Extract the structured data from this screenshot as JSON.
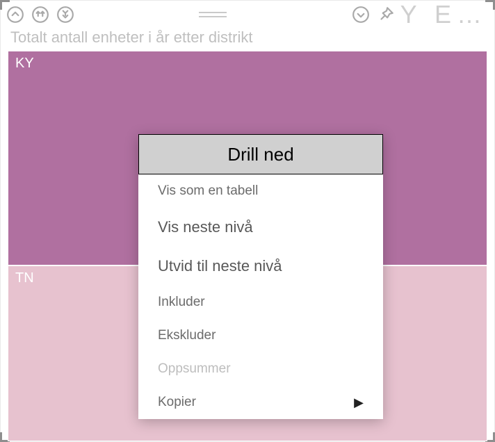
{
  "toolbar": {
    "collapsed_title": "Y E…"
  },
  "chart": {
    "title": "Totalt antall enheter i år etter distrikt"
  },
  "bars": {
    "ky": {
      "label": "KY"
    },
    "tn": {
      "label": "TN"
    }
  },
  "menu": {
    "drill_down": "Drill ned",
    "show_as_table": "Vis som en tabell",
    "show_next_level": "Vis neste nivå",
    "expand_next_level": "Utvid til neste nivå",
    "include": "Inkluder",
    "exclude": "Ekskluder",
    "summarize": "Oppsummer",
    "copy": "Kopier"
  },
  "chart_data": {
    "type": "bar",
    "title": "Totalt antall enheter i år etter distrikt",
    "categories": [
      "KY",
      "TN"
    ],
    "series": [
      {
        "name": "Totalt antall enheter i år",
        "values": [
          55,
          45
        ]
      }
    ],
    "note": "values are relative proportions estimated from bar heights; no axis labels present"
  }
}
